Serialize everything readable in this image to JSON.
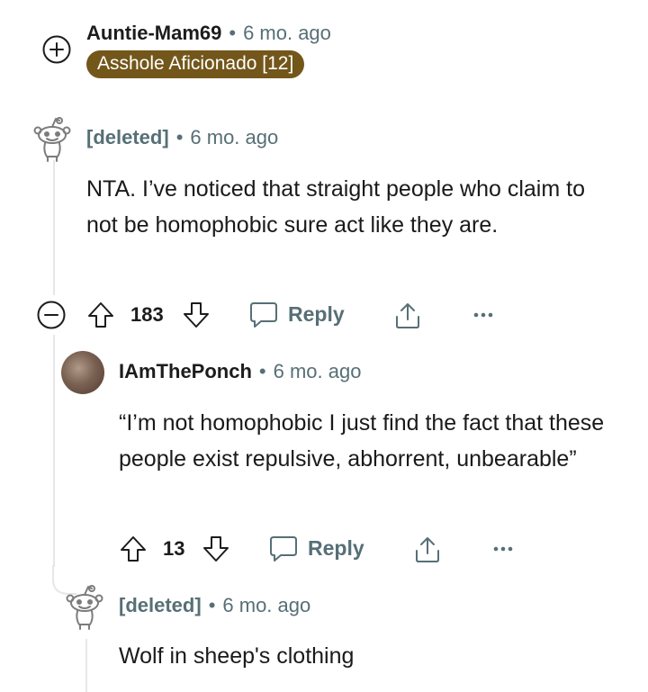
{
  "comments": [
    {
      "username": "Auntie-Mam69",
      "separator": "•",
      "time": "6 mo. ago",
      "flair": "Asshole Aficionado [12]",
      "toggle_icon": "expand-plus-icon"
    },
    {
      "username": "[deleted]",
      "separator": "•",
      "time": "6 mo. ago",
      "avatar_icon": "snoo-deleted-icon",
      "body": "NTA. I’ve noticed that straight people who claim to not be homophobic sure act like they are.",
      "votes": "183",
      "reply_label": "Reply",
      "toggle_icon": "collapse-minus-icon"
    },
    {
      "username": "IAmThePonch",
      "separator": "•",
      "time": "6 mo. ago",
      "avatar_icon": "user-avatar",
      "body": "“I’m not homophobic I just find the fact that these people exist repulsive, abhorrent, unbearable”",
      "votes": "13",
      "reply_label": "Reply"
    },
    {
      "username": "[deleted]",
      "separator": "•",
      "time": "6 mo. ago",
      "avatar_icon": "snoo-deleted-icon",
      "body": "Wolf in sheep's clothing"
    }
  ],
  "colors": {
    "flair_bg": "#73561a",
    "meta_gray": "#576f76",
    "thread_line": "#e5e7e8"
  }
}
